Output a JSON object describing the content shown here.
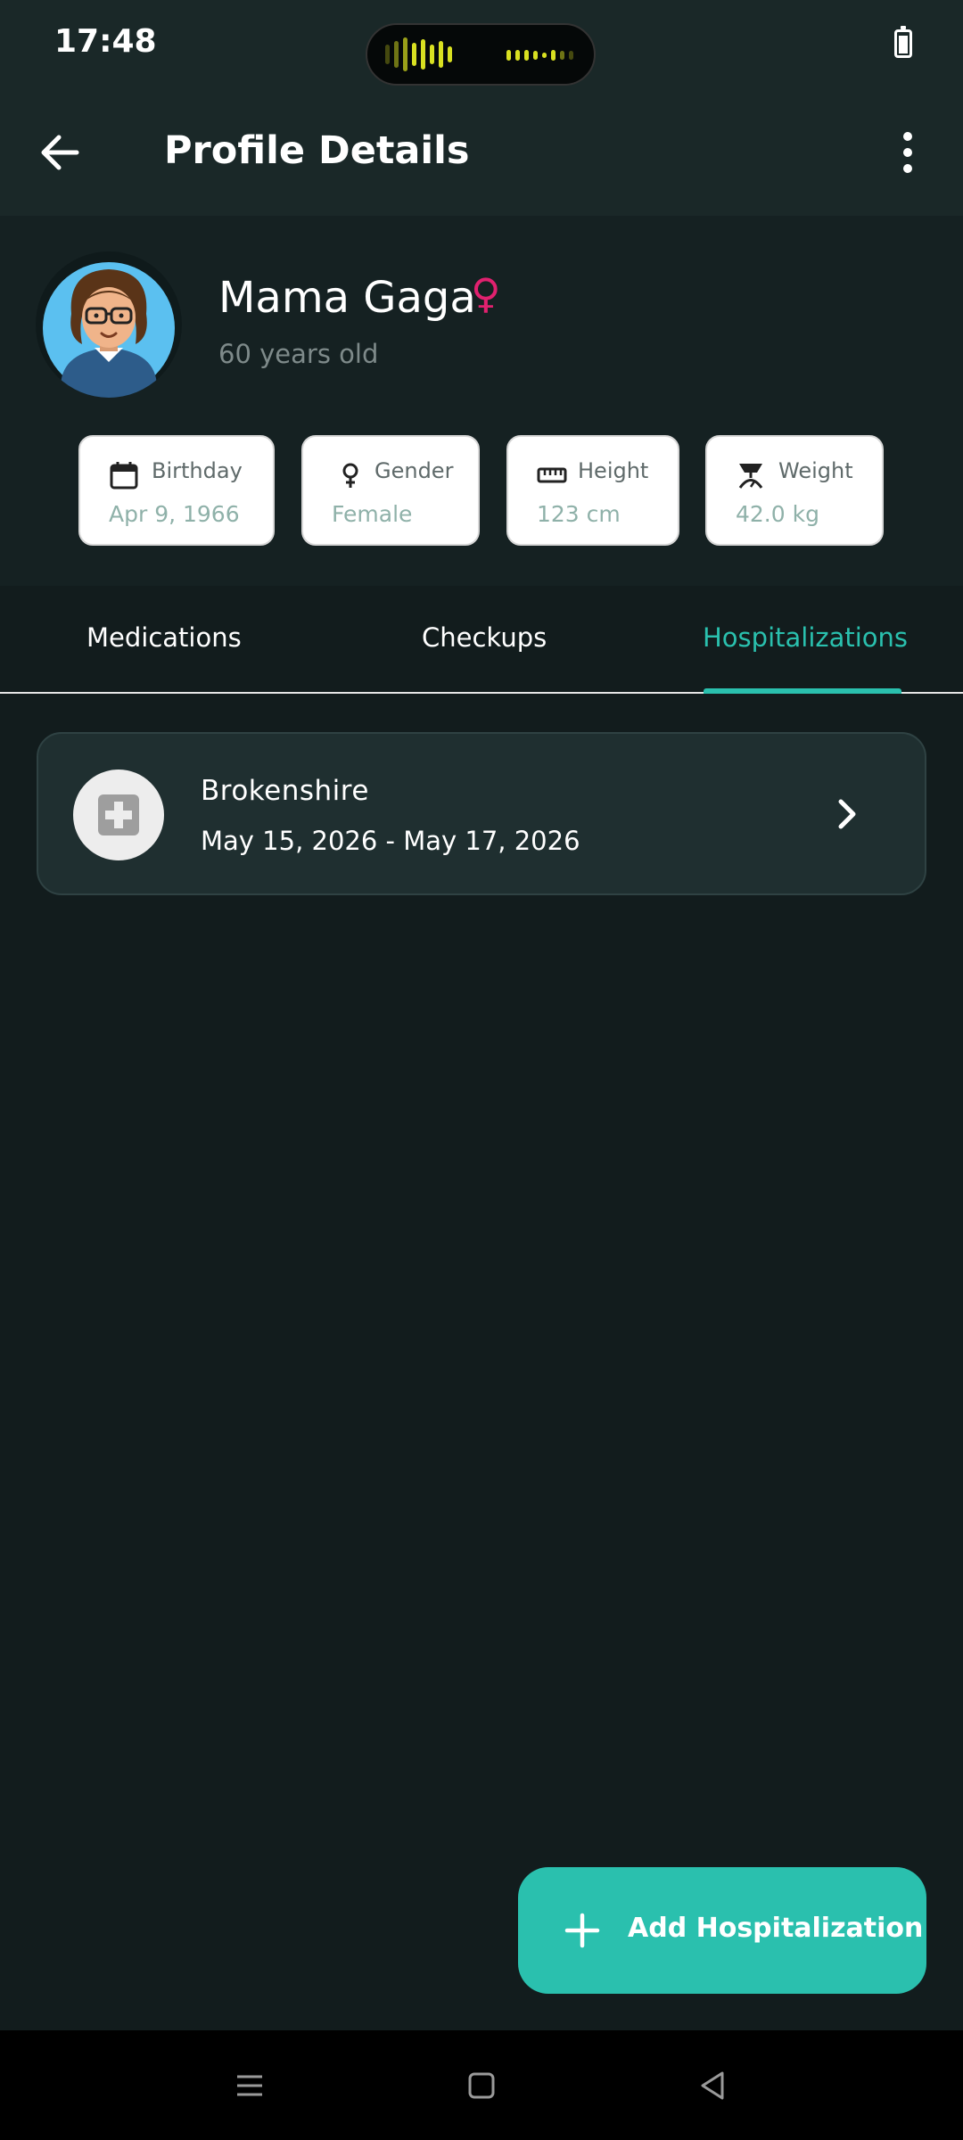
{
  "status_bar": {
    "time": "17:48"
  },
  "app_bar": {
    "title": "Profile Details"
  },
  "profile": {
    "name": "Mama Gaga",
    "gender_symbol": "♀",
    "age": "60 years old",
    "cards": [
      {
        "label": "Birthday",
        "value": "Apr 9, 1966",
        "icon": "calendar-icon"
      },
      {
        "label": "Gender",
        "value": "Female",
        "icon": "female-icon"
      },
      {
        "label": "Height",
        "value": "123 cm",
        "icon": "ruler-icon"
      },
      {
        "label": "Weight",
        "value": "42.0 kg",
        "icon": "scale-icon"
      }
    ]
  },
  "tabs": [
    {
      "label": "Medications",
      "active": false
    },
    {
      "label": "Checkups",
      "active": false
    },
    {
      "label": "Hospitalizations",
      "active": true
    }
  ],
  "hospitalizations": [
    {
      "name": "Brokenshire",
      "dates": "May 15, 2026 - May 17, 2026",
      "icon": "hospital-cross-icon"
    }
  ],
  "fab": {
    "label": "Add Hospitalization",
    "icon": "plus-icon"
  },
  "colors": {
    "accent": "#2AC0AE",
    "female": "#E0216F",
    "background": "#121C1D",
    "appbar": "#1A2828"
  }
}
